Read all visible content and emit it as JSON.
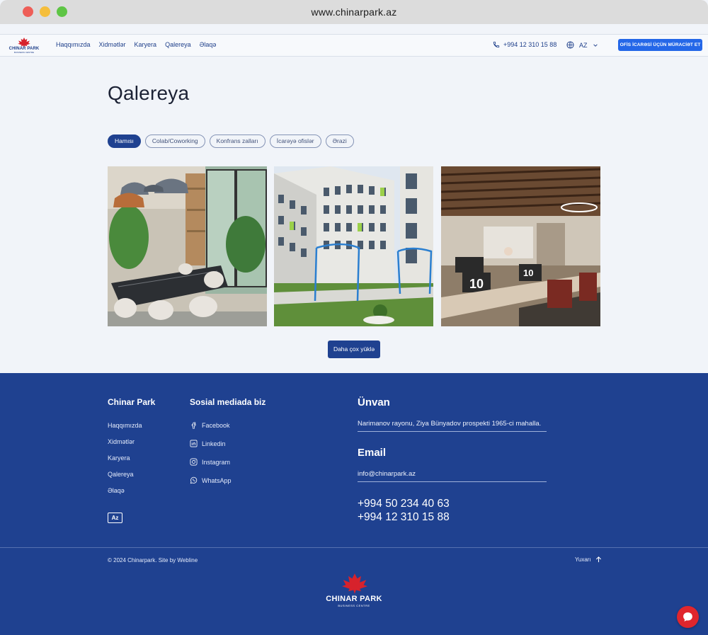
{
  "browser": {
    "url": "www.chinarpark.az"
  },
  "brand": {
    "name": "CHINAR PARK",
    "sub": "BUSINESS CENTRE",
    "leaf_color": "#d7222c",
    "primary": "#1f4190",
    "accent": "#2467e8"
  },
  "nav": {
    "items": [
      "Haqqımızda",
      "Xidmətlər",
      "Karyera",
      "Qalereya",
      "Əlaqə"
    ]
  },
  "header": {
    "phone": "+994 12 310 15 88",
    "language": "AZ",
    "cta": "OFİS İCARƏSİ ÜÇÜN MÜRACİƏT ET"
  },
  "main": {
    "title": "Qalereya",
    "filters": [
      {
        "label": "Hamısı",
        "active": true
      },
      {
        "label": "Colab/Coworking",
        "active": false
      },
      {
        "label": "Konfrans zalları",
        "active": false
      },
      {
        "label": "İcarəyə ofislər",
        "active": false
      },
      {
        "label": "Ərazi",
        "active": false
      }
    ],
    "load_more": "Daha çox yüklə"
  },
  "footer": {
    "col1": {
      "title": "Chinar Park",
      "links": [
        "Haqqımızda",
        "Xidmətlər",
        "Karyera",
        "Qalereya",
        "Əlaqə"
      ]
    },
    "col2": {
      "title": "Sosial mediada biz",
      "links": [
        "Facebook",
        "Linkedin",
        "Instagram",
        "WhatsApp"
      ]
    },
    "lang_badge": "Az",
    "address": {
      "title": "Ünvan",
      "value": "Narimanov rayonu, Ziya Bünyadov prospekti 1965-ci mahalla."
    },
    "email": {
      "title": "Email",
      "value": "info@chinarpark.az"
    },
    "phones": [
      "+994 50 234 40 63",
      "+994 12 310 15 88"
    ],
    "copyright": "© 2024 Chinarpark. Site by Webline",
    "to_top": "Yuxarı"
  }
}
